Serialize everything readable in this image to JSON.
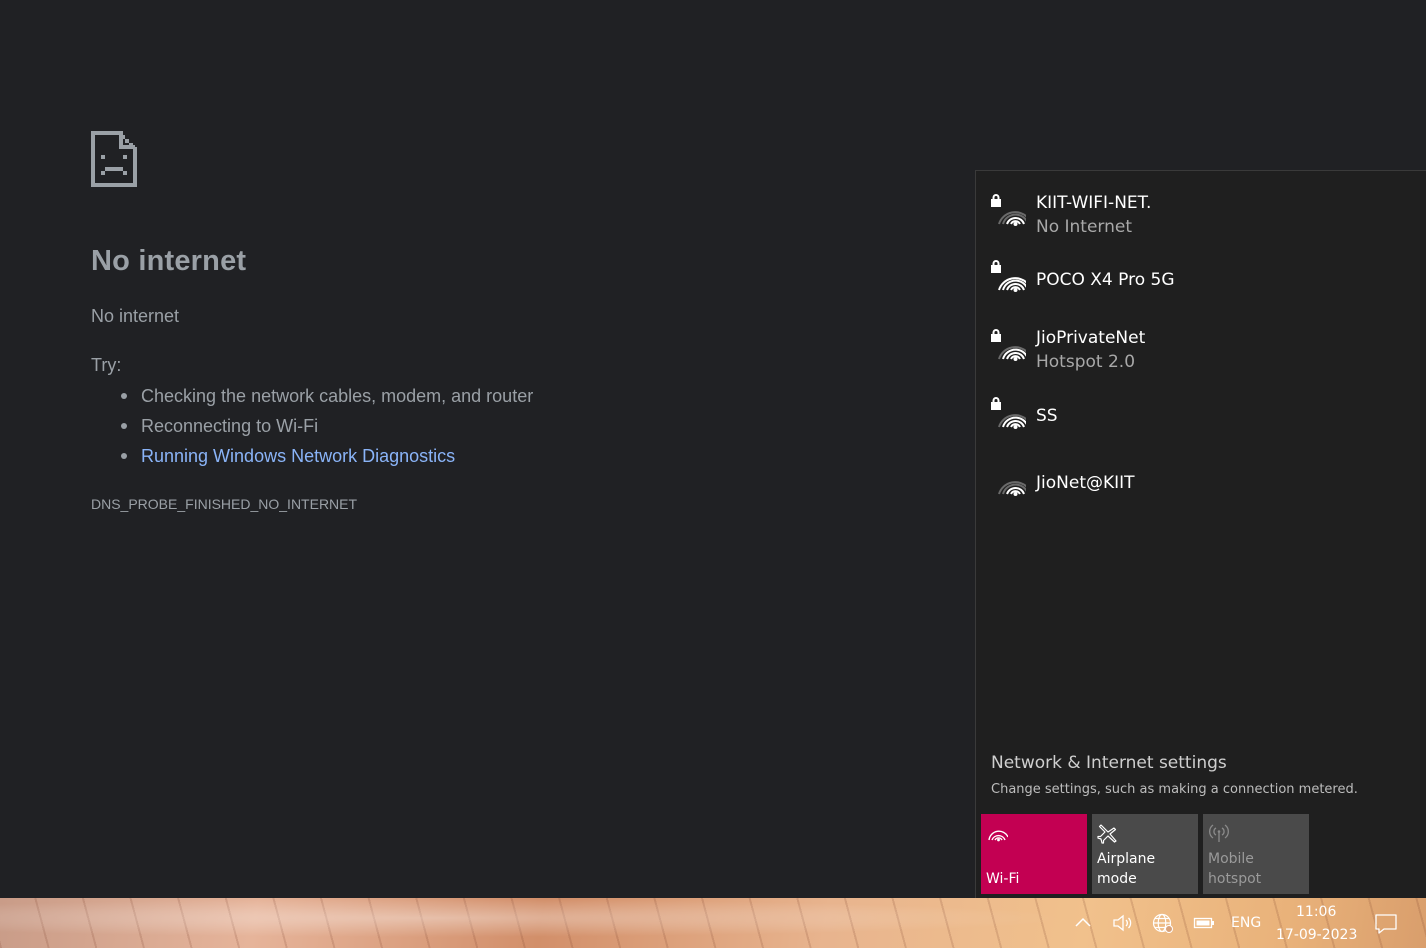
{
  "error_page": {
    "icon": "sad-page-icon",
    "title": "No internet",
    "subtitle": "No internet",
    "try_label": "Try:",
    "suggestions": [
      "Checking the network cables, modem, and router",
      "Reconnecting to Wi-Fi",
      "Running Windows Network Diagnostics"
    ],
    "error_code": "DNS_PROBE_FINISHED_NO_INTERNET",
    "link_color": "#8ab4f8"
  },
  "network_flyout": {
    "networks": [
      {
        "name": "KIIT-WIFI-NET.",
        "status": "No Internet",
        "secured": true,
        "icon": "wifi-secured-icon"
      },
      {
        "name": "POCO X4 Pro 5G",
        "status": "",
        "secured": true,
        "icon": "wifi-secured-icon"
      },
      {
        "name": "JioPrivateNet",
        "status": "Hotspot 2.0",
        "secured": true,
        "icon": "wifi-secured-icon"
      },
      {
        "name": "SS",
        "status": "",
        "secured": true,
        "icon": "wifi-secured-icon"
      },
      {
        "name": "JioNet@KIIT",
        "status": "",
        "secured": false,
        "icon": "wifi-icon"
      }
    ],
    "settings_link": "Network & Internet settings",
    "settings_desc": "Change settings, such as making a connection metered.",
    "tiles": {
      "wifi": {
        "label": "Wi-Fi",
        "active": true,
        "color": "#c30052"
      },
      "airplane": {
        "label": "Airplane mode",
        "active": false
      },
      "hotspot": {
        "label_line1": "Mobile",
        "label_line2": "hotspot",
        "active": false
      }
    }
  },
  "taskbar": {
    "language": "ENG",
    "time": "11:06",
    "date": "17-09-2023",
    "tray_icons": [
      "chevron-up-icon",
      "volume-icon",
      "globe-network-icon",
      "battery-icon",
      "notification-icon"
    ]
  }
}
